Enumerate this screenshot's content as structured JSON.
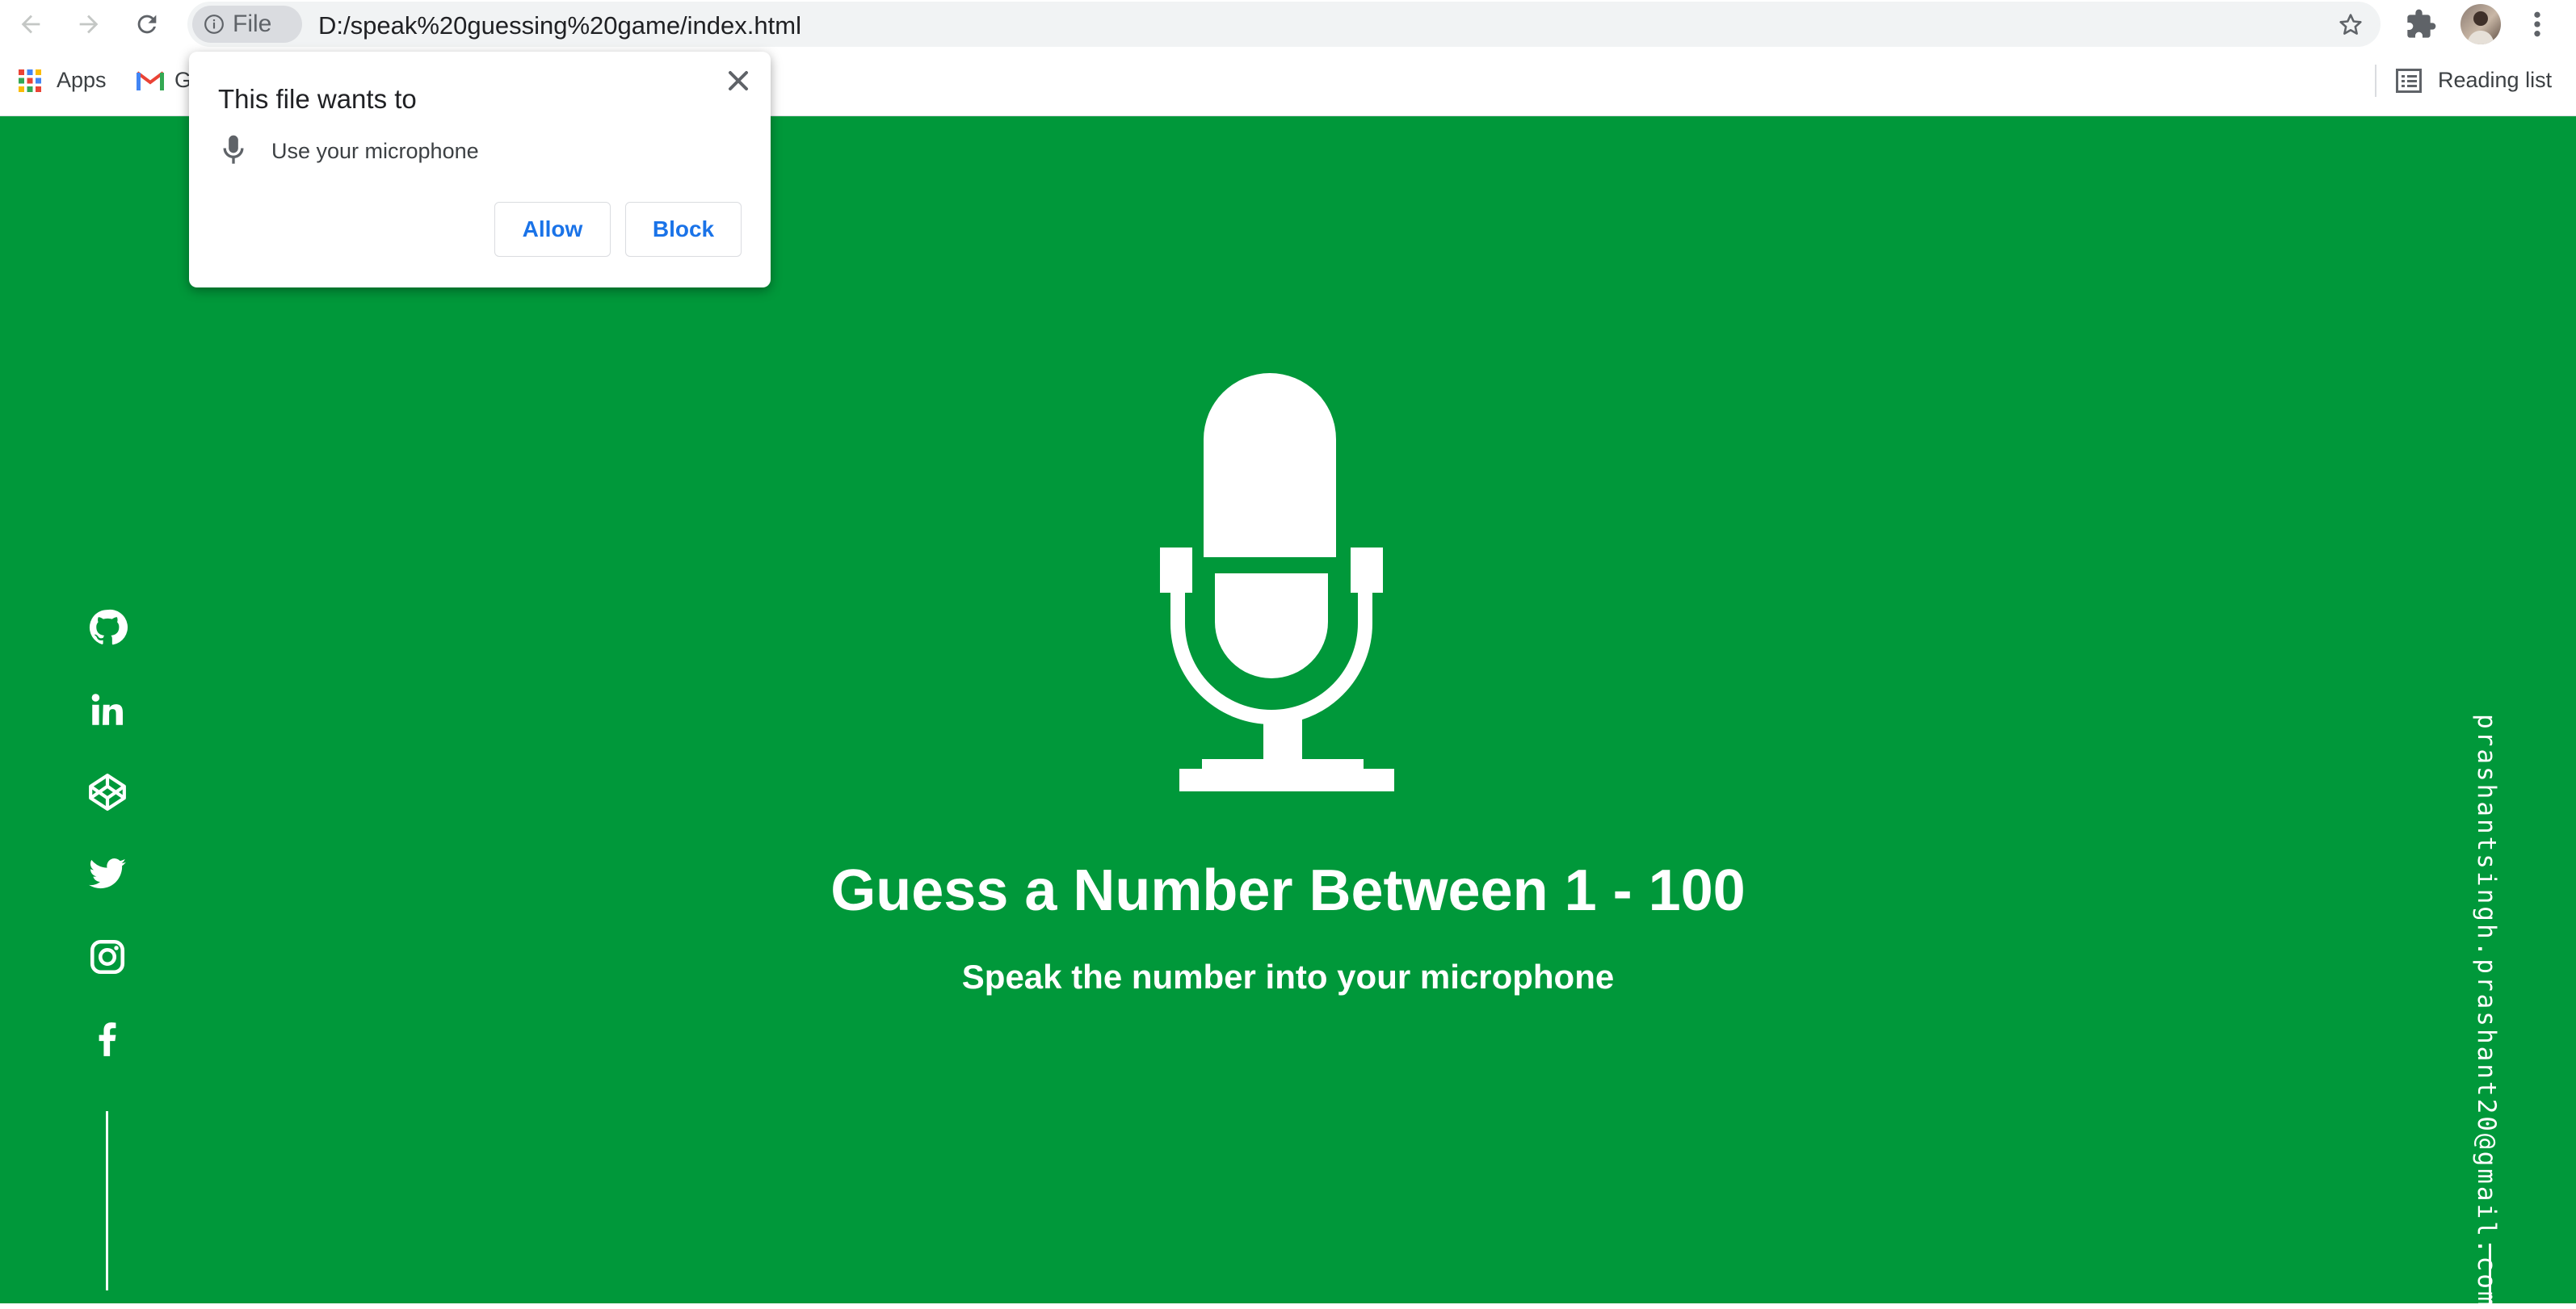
{
  "browser": {
    "site_chip_label": "File",
    "url": "D:/speak%20guessing%20game/index.html"
  },
  "bookmarks": {
    "apps_label": "Apps",
    "gmail_label": "G",
    "reading_list_label": "Reading list"
  },
  "permission_popup": {
    "heading": "This file wants to",
    "permission": "Use your microphone",
    "allow_label": "Allow",
    "block_label": "Block"
  },
  "page": {
    "title": "Guess a Number Between 1 - 100",
    "subtitle": "Speak the number into your microphone",
    "email": "prashantsingh.prashant20@gmail.com",
    "social_icons": [
      "github-icon",
      "linkedin-icon",
      "codepen-icon",
      "twitter-icon",
      "instagram-icon",
      "facebook-icon"
    ]
  },
  "colors": {
    "page_background": "#00983a",
    "link_blue": "#1a73e8",
    "foreground": "#ffffff"
  }
}
